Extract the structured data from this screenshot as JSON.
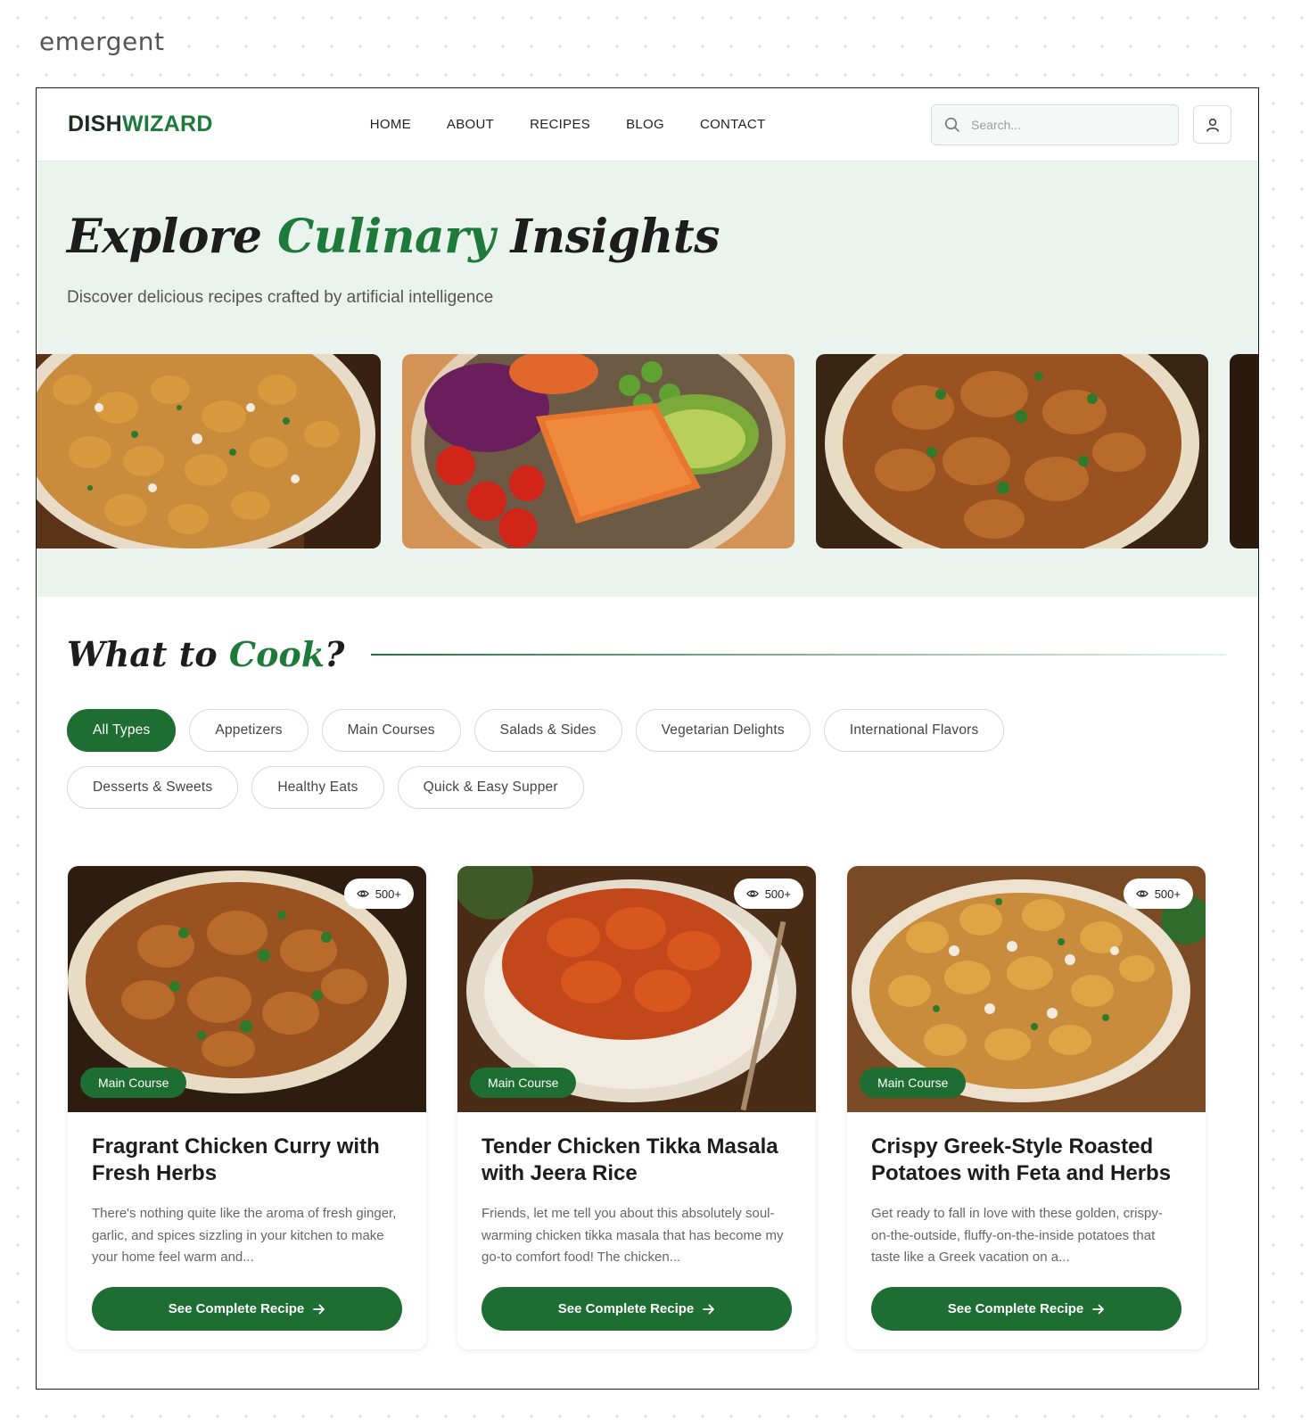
{
  "brand_mark": "emergent",
  "nav": {
    "logo_part1": "DISH",
    "logo_part2": "WIZARD",
    "items": [
      "HOME",
      "ABOUT",
      "RECIPES",
      "BLOG",
      "CONTACT"
    ],
    "search_placeholder": "Search..."
  },
  "hero": {
    "title_part1": "Explore ",
    "title_part2": "Culinary",
    "title_part3": " Insights",
    "subtitle": "Discover delicious recipes crafted by artificial intelligence"
  },
  "section": {
    "title_part1": "What to ",
    "title_part2": "Cook",
    "title_part3": "?"
  },
  "filters": {
    "row1": [
      "All Types",
      "Appetizers",
      "Main Courses",
      "Salads & Sides",
      "Vegetarian Delights",
      "International Flavors"
    ],
    "row2": [
      "Desserts & Sweets",
      "Healthy Eats",
      "Quick & Easy Supper"
    ],
    "active": "All Types"
  },
  "cards": [
    {
      "views": "500+",
      "tag": "Main Course",
      "title": "Fragrant Chicken Curry with Fresh Herbs",
      "description": "There's nothing quite like the aroma of fresh ginger, garlic, and spices sizzling in your kitchen to make your home feel warm and...",
      "button": "See Complete Recipe"
    },
    {
      "views": "500+",
      "tag": "Main Course",
      "title": "Tender Chicken Tikka Masala with Jeera Rice",
      "description": "Friends, let me tell you about this absolutely soul-warming chicken tikka masala that has become my go-to comfort food! The chicken...",
      "button": "See Complete Recipe"
    },
    {
      "views": "500+",
      "tag": "Main Course",
      "title": "Crispy Greek-Style Roasted Potatoes with Feta and Herbs",
      "description": "Get ready to fall in love with these golden, crispy-on-the-outside, fluffy-on-the-inside potatoes that taste like a Greek vacation on a...",
      "button": "See Complete Recipe"
    }
  ],
  "colors": {
    "accent": "#1e7a3a",
    "button": "#1e6e34",
    "hero_bg": "#ebf3ef"
  }
}
